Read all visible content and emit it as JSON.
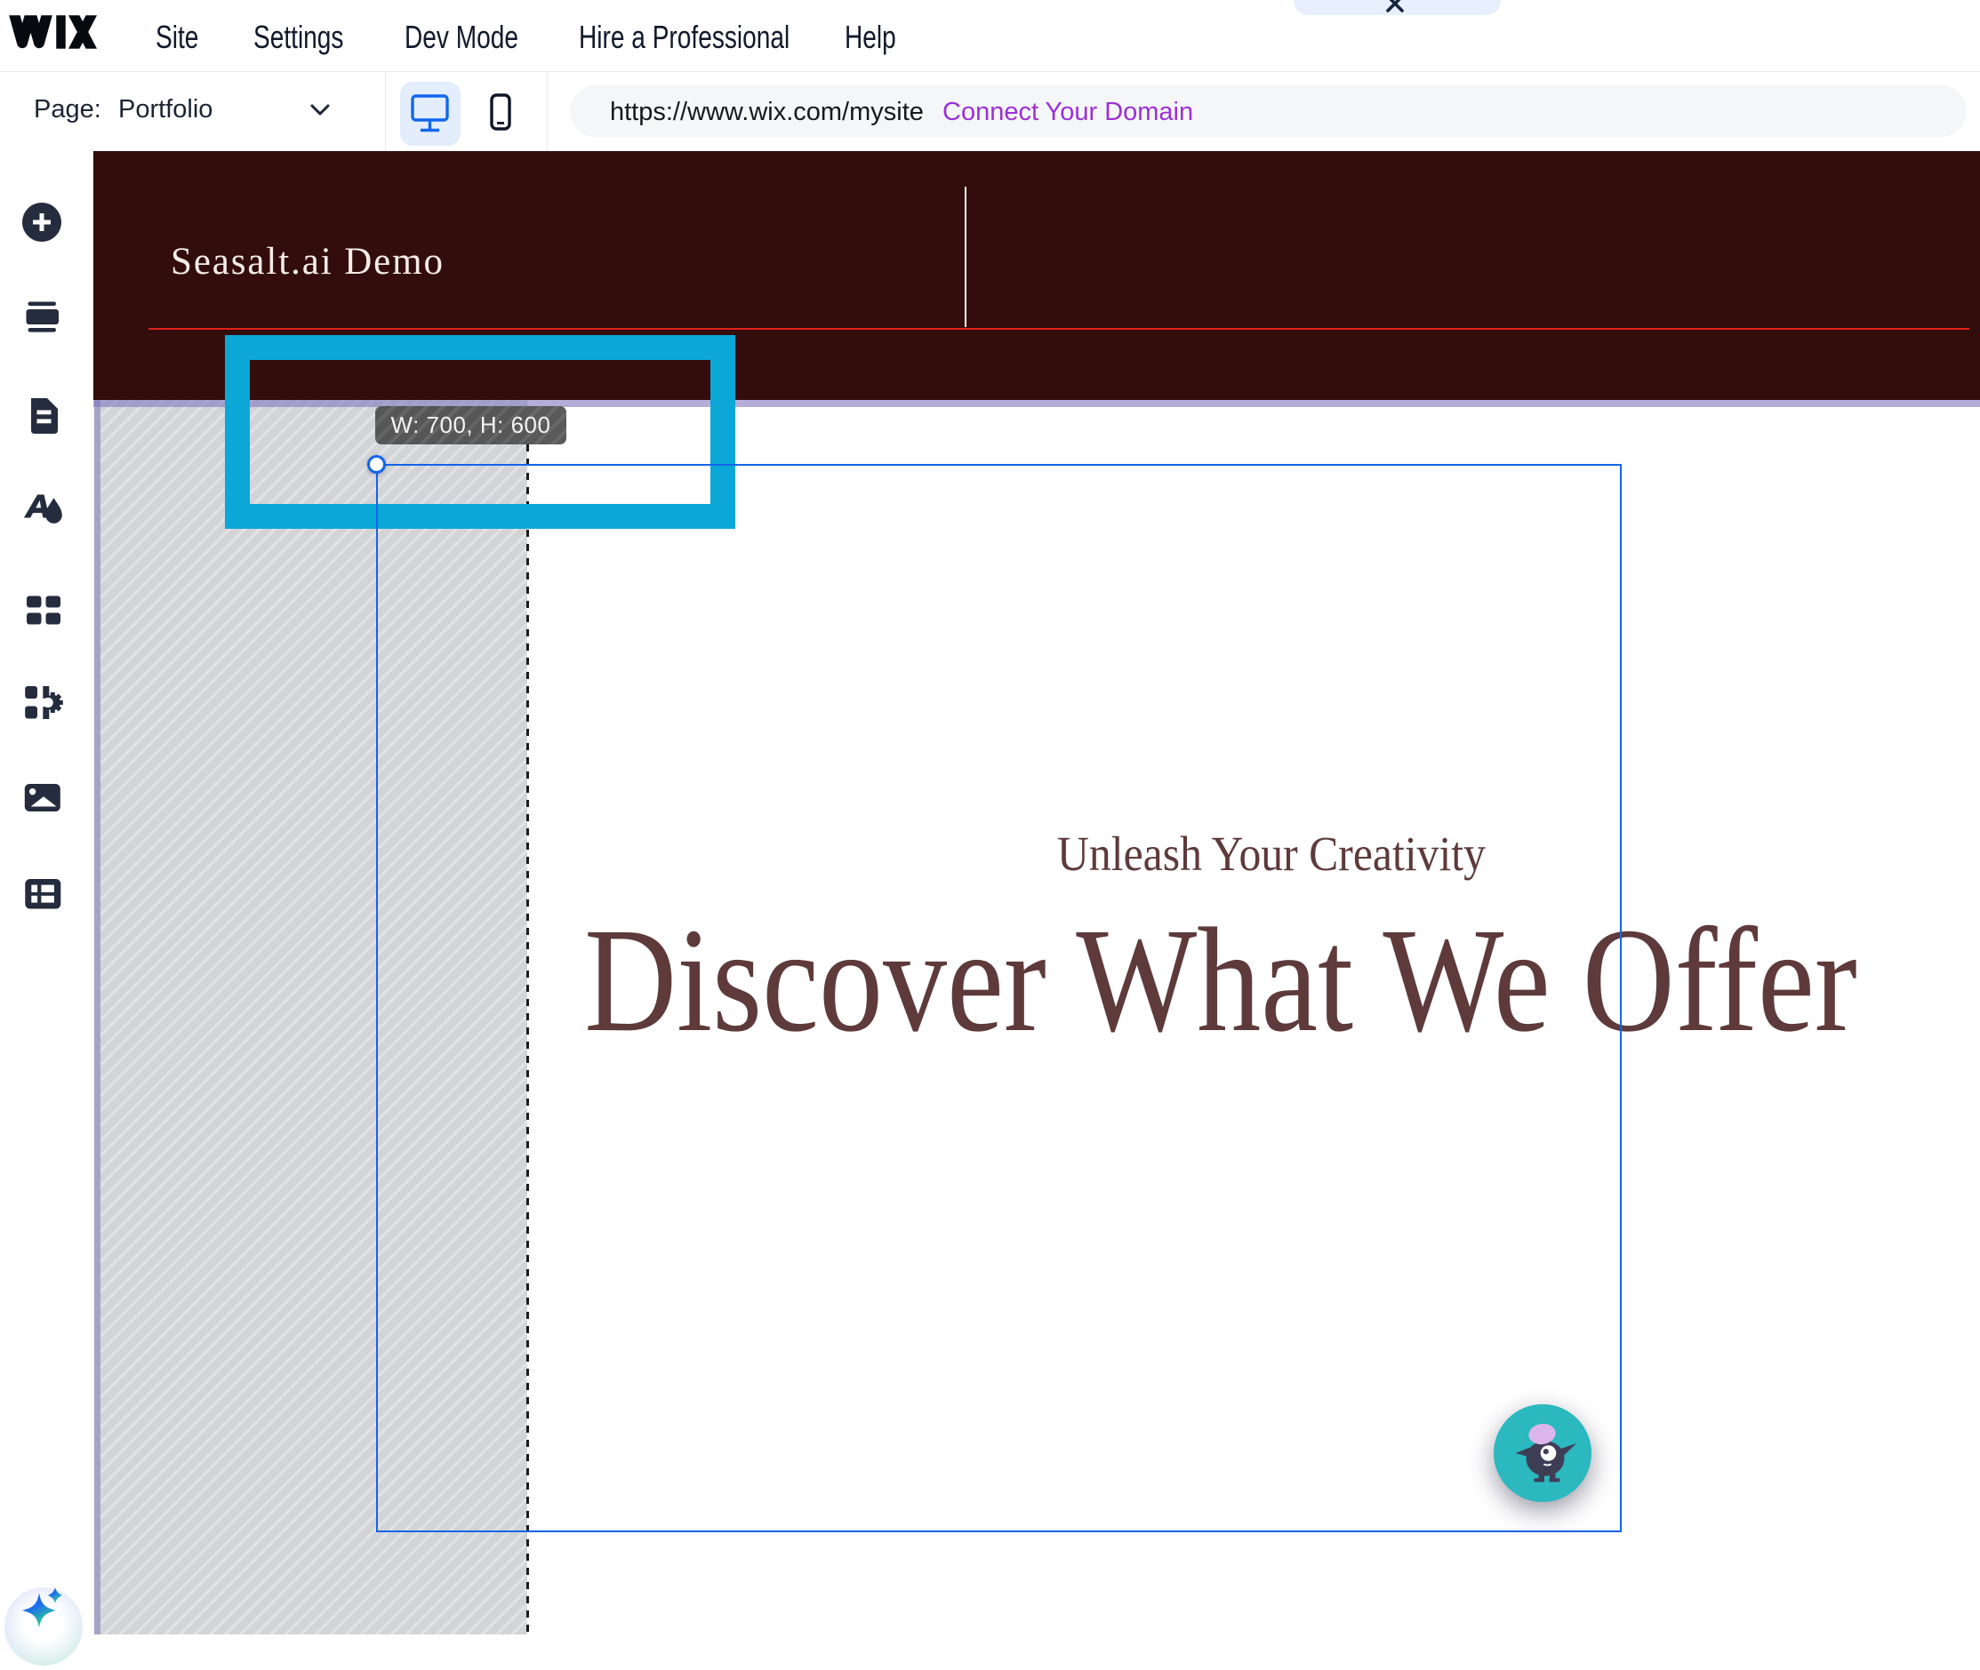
{
  "topbar": {
    "logo": "WIX",
    "menu": [
      "Site",
      "Settings",
      "Dev Mode",
      "Hire a Professional",
      "Help"
    ]
  },
  "toolbar": {
    "page_label": "Page:",
    "page_value": "Portfolio",
    "url": "https://www.wix.com/mysite",
    "connect_link": "Connect Your Domain"
  },
  "sidebar": {
    "icons": [
      "add-elements",
      "add-section",
      "pages",
      "site-design",
      "add-apps",
      "app-market",
      "media",
      "content-manager"
    ],
    "ai_button": "ai-assistant"
  },
  "canvas": {
    "site_title": "Seasalt.ai Demo",
    "hero": {
      "subtitle": "Unleash Your Creativity",
      "heading": "Discover What We Offer"
    },
    "selection_tooltip": "W: 700, H: 600"
  },
  "colors": {
    "header_background": "#330d0b",
    "header_accent_line": "#e0211a",
    "hero_text": "#5e3a3a",
    "selection_blue": "#1465e6",
    "annotation_cyan": "#0ba7d7",
    "chat_widget_teal": "#2bb8bf",
    "connect_link_purple": "#9c2fd6",
    "device_active_bg": "#e3edfc"
  }
}
